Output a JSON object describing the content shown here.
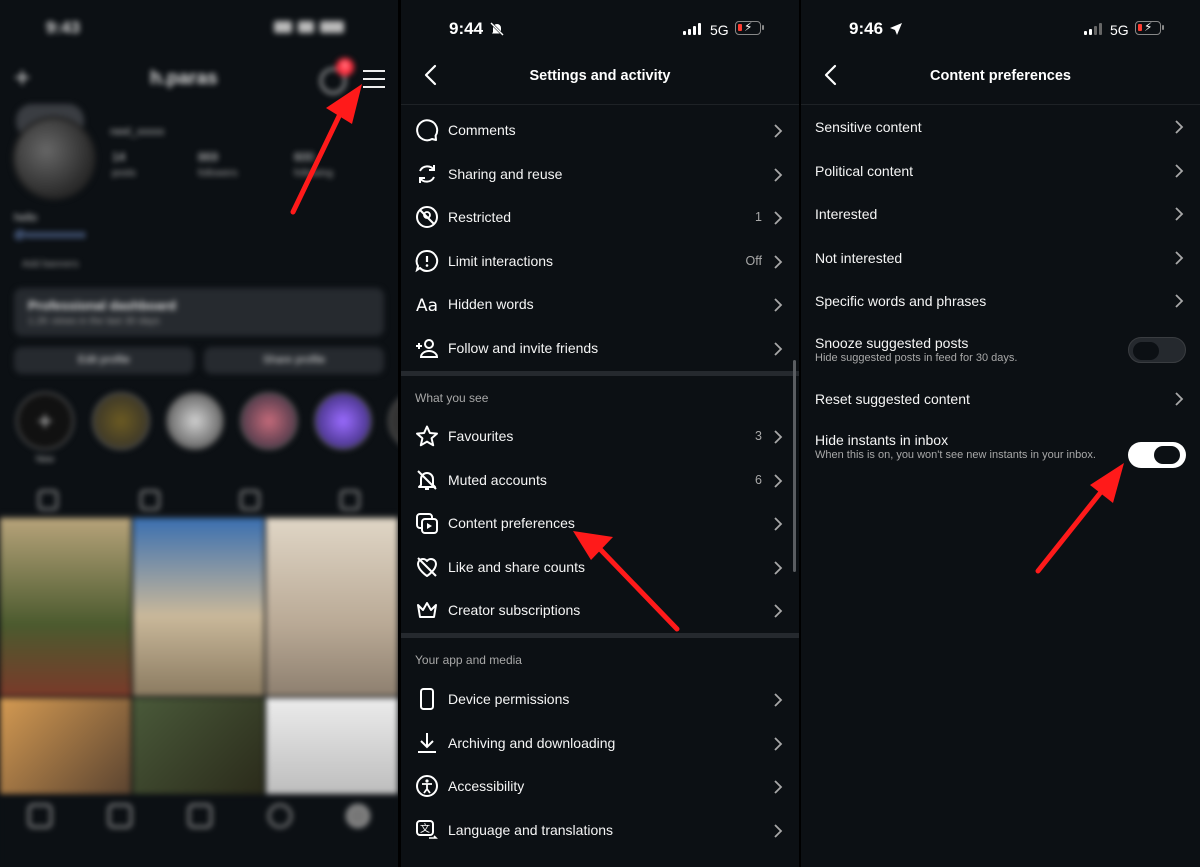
{
  "panel1": {
    "status_time": "9:43",
    "username": "h.paras",
    "handle": "neel_xxxxx",
    "notification_count": "5",
    "stats": [
      {
        "value": "14",
        "label": "posts"
      },
      {
        "value": "869",
        "label": "followers"
      },
      {
        "value": "600",
        "label": "following"
      }
    ],
    "bio": "hello",
    "add_banner": "Add banners",
    "dashboard_title": "Professional dashboard",
    "dashboard_sub": "1.2K views in the last 30 days",
    "edit_profile": "Edit profile",
    "share_profile": "Share profile",
    "highlights": [
      "New",
      "",
      "",
      "",
      "",
      ""
    ]
  },
  "panel2": {
    "status_time": "9:44",
    "network": "5G",
    "title": "Settings and activity",
    "rows_top": [
      {
        "icon": "comment-icon",
        "label": "Comments",
        "value": ""
      },
      {
        "icon": "repost-icon",
        "label": "Sharing and reuse",
        "value": ""
      },
      {
        "icon": "restricted-icon",
        "label": "Restricted",
        "value": "1"
      },
      {
        "icon": "alert-circle-icon",
        "label": "Limit interactions",
        "value": "Off"
      },
      {
        "icon": "text-aa-icon",
        "label": "Hidden words",
        "value": ""
      },
      {
        "icon": "add-person-icon",
        "label": "Follow and invite friends",
        "value": ""
      }
    ],
    "section_what_you_see": "What you see",
    "rows_see": [
      {
        "icon": "star-icon",
        "label": "Favourites",
        "value": "3"
      },
      {
        "icon": "muted-bell-icon",
        "label": "Muted accounts",
        "value": "6"
      },
      {
        "icon": "content-preferences-icon",
        "label": "Content preferences",
        "value": ""
      },
      {
        "icon": "heart-off-icon",
        "label": "Like and share counts",
        "value": ""
      },
      {
        "icon": "crown-icon",
        "label": "Creator subscriptions",
        "value": ""
      }
    ],
    "section_app_media": "Your app and media",
    "rows_app": [
      {
        "icon": "phone-icon",
        "label": "Device permissions",
        "value": ""
      },
      {
        "icon": "download-icon",
        "label": "Archiving and downloading",
        "value": ""
      },
      {
        "icon": "accessibility-icon",
        "label": "Accessibility",
        "value": ""
      },
      {
        "icon": "translate-icon",
        "label": "Language and translations",
        "value": ""
      }
    ]
  },
  "panel3": {
    "status_time": "9:46",
    "network": "5G",
    "title": "Content preferences",
    "rows": [
      {
        "label": "Sensitive content"
      },
      {
        "label": "Political content"
      },
      {
        "label": "Interested"
      },
      {
        "label": "Not interested"
      },
      {
        "label": "Specific words and phrases"
      }
    ],
    "snooze": {
      "label": "Snooze suggested posts",
      "sub": "Hide suggested posts in feed for 30 days.",
      "on": false
    },
    "reset": {
      "label": "Reset suggested content"
    },
    "hide_instants": {
      "label": "Hide instants in inbox",
      "sub": "When this is on, you won't see new instants in your inbox.",
      "on": true
    }
  },
  "colors": {
    "background": "#0c1014",
    "divider": "#25292e",
    "secondary_text": "#a8a8a8",
    "annotation_arrow": "#ff1a1a",
    "badge": "#ff3040"
  }
}
